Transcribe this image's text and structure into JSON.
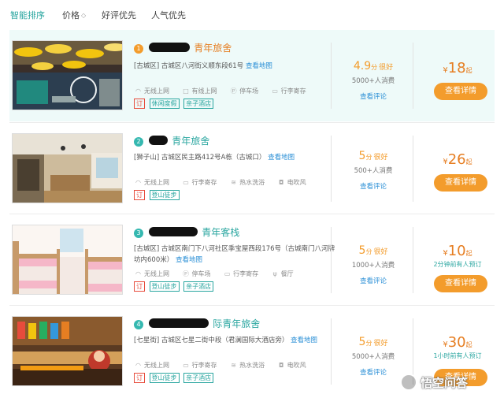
{
  "sort_bar": {
    "items": [
      "智能排序",
      "价格",
      "好评优先",
      "人气优先"
    ],
    "active_index": 0,
    "price_caret": "◇"
  },
  "listings": [
    {
      "rank": "1",
      "name_suffix": "青年旅舍",
      "address": "[古城区] 古城区八河街义顺东段61号",
      "map_link": "查看地图",
      "features": [
        "无线上网",
        "有线上网",
        "停车场",
        "行李寄存"
      ],
      "tags": [
        {
          "text": "订",
          "color": "red"
        },
        {
          "text": "休闲度假",
          "color": "teal"
        },
        {
          "text": "亲子酒店",
          "color": "teal"
        }
      ],
      "score": "4.9",
      "score_unit": "分",
      "rating_word": "很好",
      "consumers": "5000+人消费",
      "review_link": "查看评论",
      "currency": "¥",
      "price": "18",
      "price_suffix": "起",
      "recent": "",
      "button": "查看详情",
      "accent": "#f39c2c"
    },
    {
      "rank": "2",
      "name_suffix": "青年旅舍",
      "address": "[狮子山] 古城区民主路412号A栋（古城口）",
      "map_link": "查看地图",
      "features": [
        "无线上网",
        "行李寄存",
        "热水洗浴",
        "电吹风"
      ],
      "tags": [
        {
          "text": "订",
          "color": "red"
        },
        {
          "text": "登山徒步",
          "color": "teal"
        }
      ],
      "score": "5",
      "score_unit": "分",
      "rating_word": "很好",
      "consumers": "500+人消费",
      "review_link": "查看评论",
      "currency": "¥",
      "price": "26",
      "price_suffix": "起",
      "recent": "",
      "button": "查看详情",
      "accent": "#35b8b0"
    },
    {
      "rank": "3",
      "name_suffix": "青年客栈",
      "address": "[古城区] 古城区南门下八河社区季宝屋西段176号（古城南门八河牌坊内600米）",
      "map_link": "查看地图",
      "features": [
        "无线上网",
        "停车场",
        "行李寄存",
        "餐厅"
      ],
      "tags": [
        {
          "text": "订",
          "color": "red"
        },
        {
          "text": "登山徒步",
          "color": "teal"
        },
        {
          "text": "亲子酒店",
          "color": "teal"
        }
      ],
      "score": "5",
      "score_unit": "分",
      "rating_word": "很好",
      "consumers": "1000+人消费",
      "review_link": "查看评论",
      "currency": "¥",
      "price": "10",
      "price_suffix": "起",
      "recent": "2分钟前有人预订",
      "button": "查看详情",
      "accent": "#35b8b0"
    },
    {
      "rank": "4",
      "name_suffix": "际青年旅舍",
      "address": "[七星街] 古城区七星二街中段（君澜国际大酒店旁）",
      "map_link": "查看地图",
      "features": [
        "无线上网",
        "行李寄存",
        "热水洗浴",
        "电吹风"
      ],
      "tags": [
        {
          "text": "订",
          "color": "red"
        },
        {
          "text": "登山徒步",
          "color": "teal"
        },
        {
          "text": "亲子酒店",
          "color": "teal"
        }
      ],
      "score": "5",
      "score_unit": "分",
      "rating_word": "很好",
      "consumers": "5000+人消费",
      "review_link": "查看评论",
      "currency": "¥",
      "price": "30",
      "price_suffix": "起",
      "recent": "1小时前有人预订",
      "button": "查看详情",
      "accent": "#35b8b0"
    }
  ],
  "watermark": {
    "text": "悟空问答"
  }
}
